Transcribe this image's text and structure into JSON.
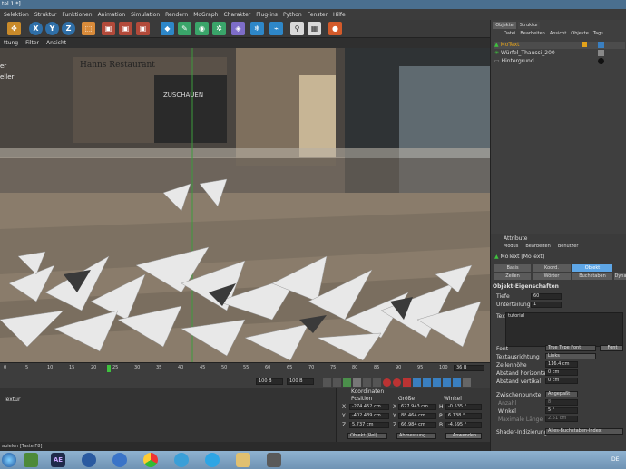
{
  "window": {
    "title": "tel 1 *]"
  },
  "menu": [
    "Selektion",
    "Struktur",
    "Funktionen",
    "Animation",
    "Simulation",
    "Rendern",
    "MoGraph",
    "Charakter",
    "Plug-ins",
    "Python",
    "Fenster",
    "Hilfe"
  ],
  "toolbar": {
    "axis_x": "X",
    "axis_y": "Y",
    "axis_z": "Z"
  },
  "view_menu": [
    "ttung",
    "Filter",
    "Ansicht"
  ],
  "viewport": {
    "sign_text": "Hanns Restaurant",
    "sign_text2": "ZUSCHAUEN",
    "left_text1": "er",
    "left_text2": "eller"
  },
  "timeline": {
    "ticks": [
      "0",
      "5",
      "10",
      "15",
      "20",
      "25",
      "30",
      "35",
      "40",
      "45",
      "50",
      "55",
      "60",
      "65",
      "70",
      "75",
      "80",
      "85",
      "90",
      "95",
      "100"
    ],
    "current_frame": "36 B",
    "field_a": "100 B",
    "field_b": "100 B"
  },
  "material": {
    "label": "Textur"
  },
  "coordinates": {
    "header": "Koordinaten",
    "col_position": "Position",
    "col_size": "Größe",
    "col_angle": "Winkel",
    "rows": [
      {
        "axis": "X",
        "pos": "-274.452 cm",
        "size_axis": "X",
        "size": "627.943 cm",
        "angle_axis": "H",
        "angle": "-0.535 °"
      },
      {
        "axis": "Y",
        "pos": "-402.439 cm",
        "size_axis": "Y",
        "size": "88.464 cm",
        "angle_axis": "P",
        "angle": "6.138 °"
      },
      {
        "axis": "Z",
        "pos": "5.737 cm",
        "size_axis": "Z",
        "size": "66.984 cm",
        "angle_axis": "B",
        "angle": "-4.595 °"
      }
    ],
    "mode_select": "Objekt (Rel)",
    "size_select": "Abmessung",
    "apply_button": "Anwenden"
  },
  "status": "apielen [Taste F8]",
  "object_manager": {
    "tabs": [
      "Objekte",
      "Struktur"
    ],
    "menu": [
      "Datei",
      "Bearbeiten",
      "Ansicht",
      "Objekte",
      "Tags"
    ],
    "items": [
      {
        "name": "MoText",
        "selected": true
      },
      {
        "name": "Würfel_Thaussi_200",
        "selected": false
      },
      {
        "name": "Hintergrund",
        "selected": false
      }
    ]
  },
  "attributes": {
    "header": "Attribute",
    "menu": [
      "Modus",
      "Bearbeiten",
      "Benutzer"
    ],
    "object_name": "MoText [MoText]",
    "tabs_row1": [
      "Basis",
      "Koord.",
      "Objekt"
    ],
    "tabs_row2": [
      "Zeilen",
      "Wörter",
      "Buchstaben",
      "Dyna"
    ],
    "section": "Objekt-Eigenschaften",
    "depth_label": "Tiefe",
    "depth_value": "60",
    "subdiv_label": "Unterteilung",
    "subdiv_value": "1",
    "text_label": "Text",
    "text_value": "tutorial",
    "font_label": "Font",
    "font_value": "True Type Font",
    "font_button": "Font",
    "align_label": "Textausrichtung",
    "align_value": "Links",
    "lineheight_label": "Zeilenhöhe",
    "lineheight_value": "116.4 cm",
    "hspace_label": "Abstand horizontal",
    "hspace_value": "0 cm",
    "vspace_label": "Abstand vertikal",
    "vspace_value": "0 cm",
    "points_label": "Zwischenpunkte",
    "points_value": "Angepaßt",
    "count_label": "Anzahl",
    "count_value": "8",
    "angle_label": "Winkel",
    "angle_value": "5 °",
    "maxlen_label": "Maximale Länge",
    "maxlen_value": "2.51 cm",
    "shader_label": "Shader-Indizierung",
    "shader_value": "Alles-Buchstaben-Index"
  },
  "taskbar": {
    "lang": "DE",
    "ae_label": "AE"
  },
  "colors": {
    "accent_blue": "#5ea6e6",
    "selected_orange": "#e3a21a",
    "taskbar": "#7fa3c3"
  }
}
